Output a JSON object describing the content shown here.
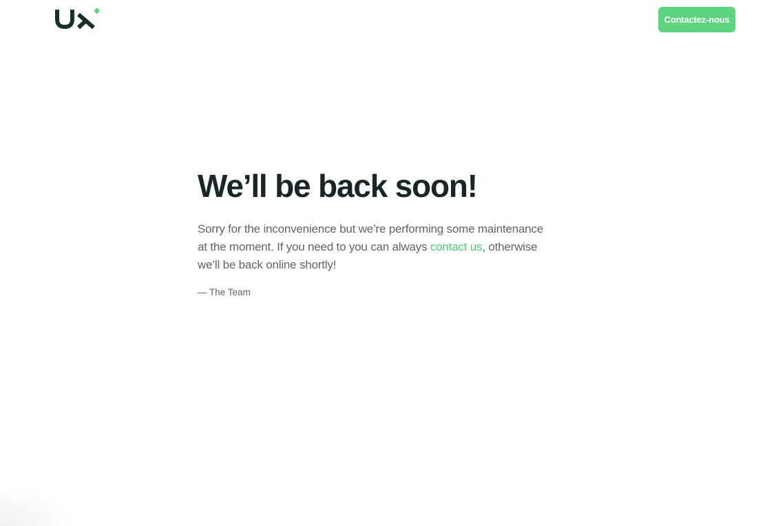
{
  "header": {
    "logo_icon": "ux-logo-icon",
    "contact_button_label": "Contactez-nous"
  },
  "main": {
    "title": "We’ll be back soon!",
    "message_part1": "Sorry for the inconvenience but we’re performing some maintenance at the moment. If you need to you can always ",
    "message_link": "contact us",
    "message_part2": ", otherwise we’ll be back online shortly!",
    "signature": "— The Team"
  },
  "colors": {
    "accent": "#5dd47d",
    "link": "#4fcf6d",
    "heading": "#182628",
    "body_text": "#5e6566",
    "logo_dark": "#17302b"
  }
}
